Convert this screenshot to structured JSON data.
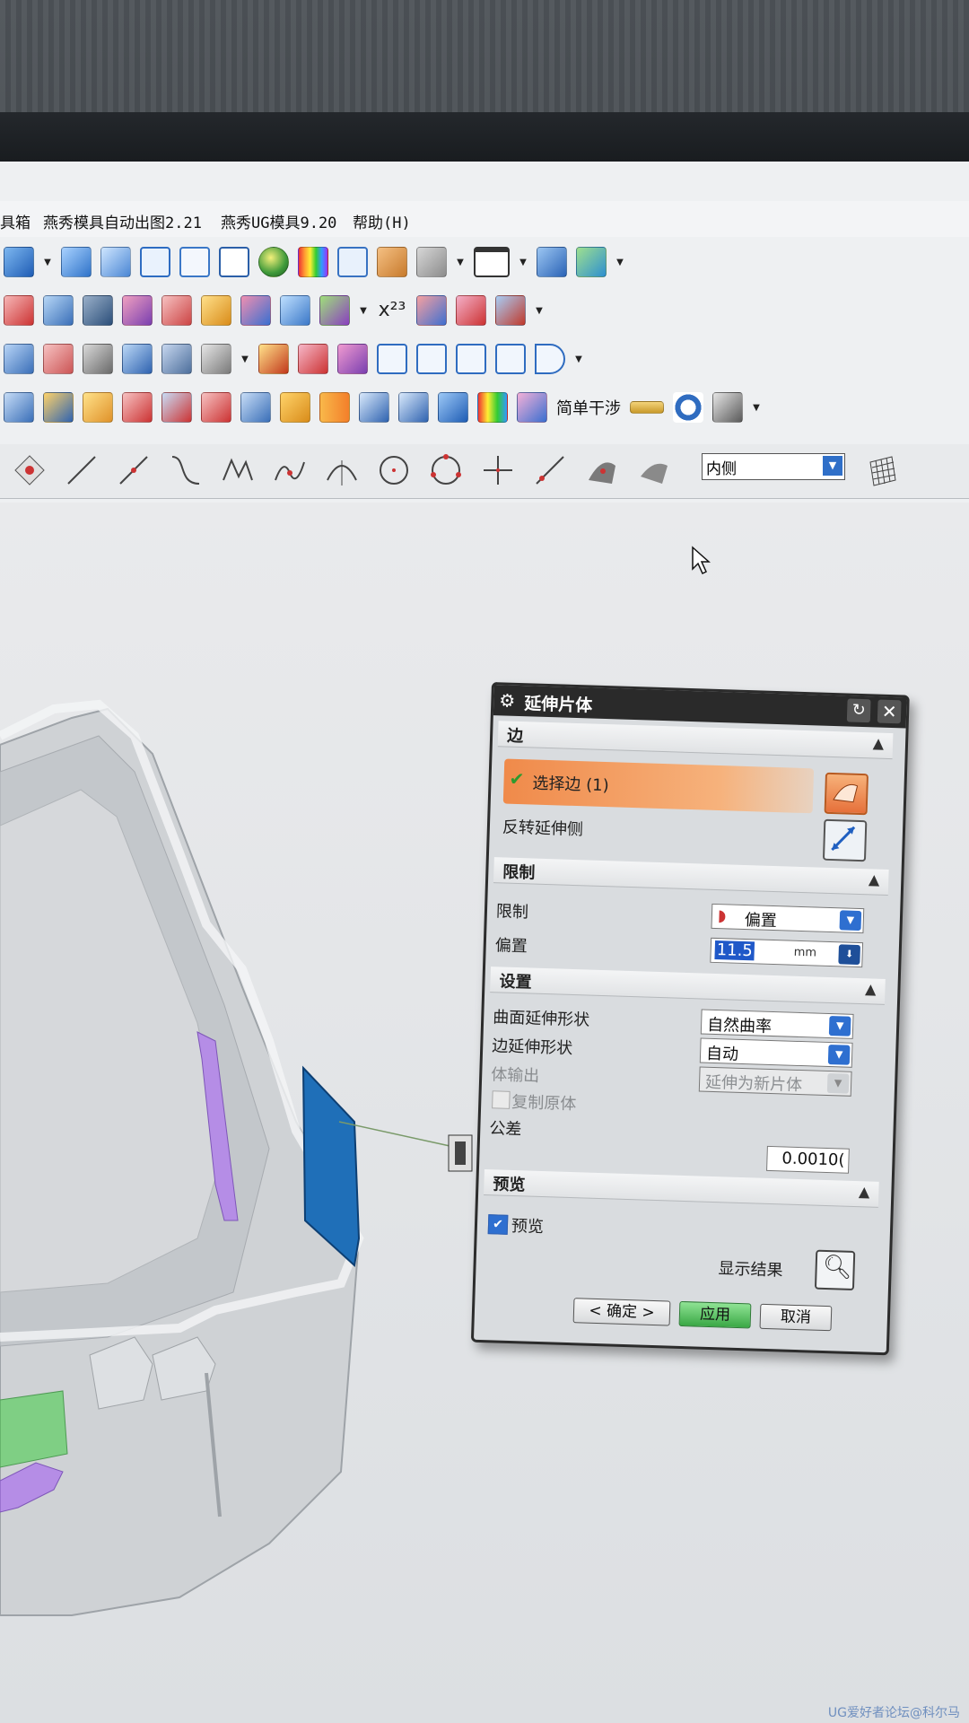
{
  "menubar": {
    "items": [
      "具箱",
      "燕秀模具自动出图2.21",
      "燕秀UG模具9.20",
      "帮助(H)"
    ]
  },
  "toolbar": {
    "simple_interference": "简单干涉"
  },
  "sketch_toolbar": {
    "side_combo": "内侧"
  },
  "dialog": {
    "title": "延伸片体",
    "sections": {
      "edge": {
        "title": "边",
        "select_edge": "选择边 (1)",
        "reverse_side": "反转延伸侧"
      },
      "limit": {
        "title": "限制",
        "limit_label": "限制",
        "limit_value": "偏置",
        "offset_label": "偏置",
        "offset_value": "11.5",
        "offset_unit": "mm"
      },
      "settings": {
        "title": "设置",
        "surface_shape_label": "曲面延伸形状",
        "surface_shape_value": "自然曲率",
        "edge_shape_label": "边延伸形状",
        "edge_shape_value": "自动",
        "body_output_label": "体输出",
        "body_output_value": "延伸为新片体",
        "copy_original_label": "复制原体",
        "tolerance_label": "公差",
        "tolerance_value": "0.0010("
      },
      "preview": {
        "title": "预览",
        "preview_label": "预览",
        "show_result_label": "显示结果"
      }
    },
    "buttons": {
      "ok": "< 确定 >",
      "apply": "应用",
      "cancel": "取消"
    }
  },
  "watermark": "UG爱好者论坛@科尔马",
  "colors": {
    "accent_orange": "#f4a060",
    "accent_blue": "#2e6fd0",
    "apply_green": "#4fbf5a",
    "extension_surface": "#1f6fb8"
  }
}
